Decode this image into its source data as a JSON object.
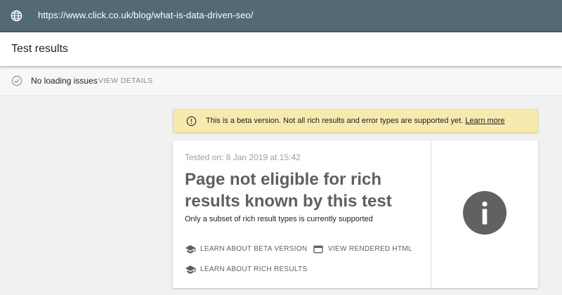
{
  "urlbar": {
    "url": "https://www.click.co.uk/blog/what-is-data-driven-seo/",
    "icon": "globe-icon"
  },
  "header": {
    "title": "Test results"
  },
  "status": {
    "text": "No loading issues",
    "view_details_label": "VIEW DETAILS",
    "icon": "check-circle-icon"
  },
  "beta_banner": {
    "message": "This is a beta version. Not all rich results and error types are supported yet.",
    "link_label": "Learn more",
    "icon": "warning-icon",
    "background_color": "#f6eaae"
  },
  "result": {
    "tested_on": "Tested on: 8 Jan 2019 at 15:42",
    "headline": "Page not eligible for rich results known by this test",
    "subtext": "Only a subset of rich result types is currently supported",
    "actions": [
      {
        "label": "LEARN ABOUT BETA VERSION",
        "icon": "school-icon"
      },
      {
        "label": "VIEW RENDERED HTML",
        "icon": "browser-icon"
      },
      {
        "label": "LEARN ABOUT RICH RESULTS",
        "icon": "school-icon"
      }
    ],
    "status_icon": "info-icon",
    "status_icon_color": "#616161"
  }
}
